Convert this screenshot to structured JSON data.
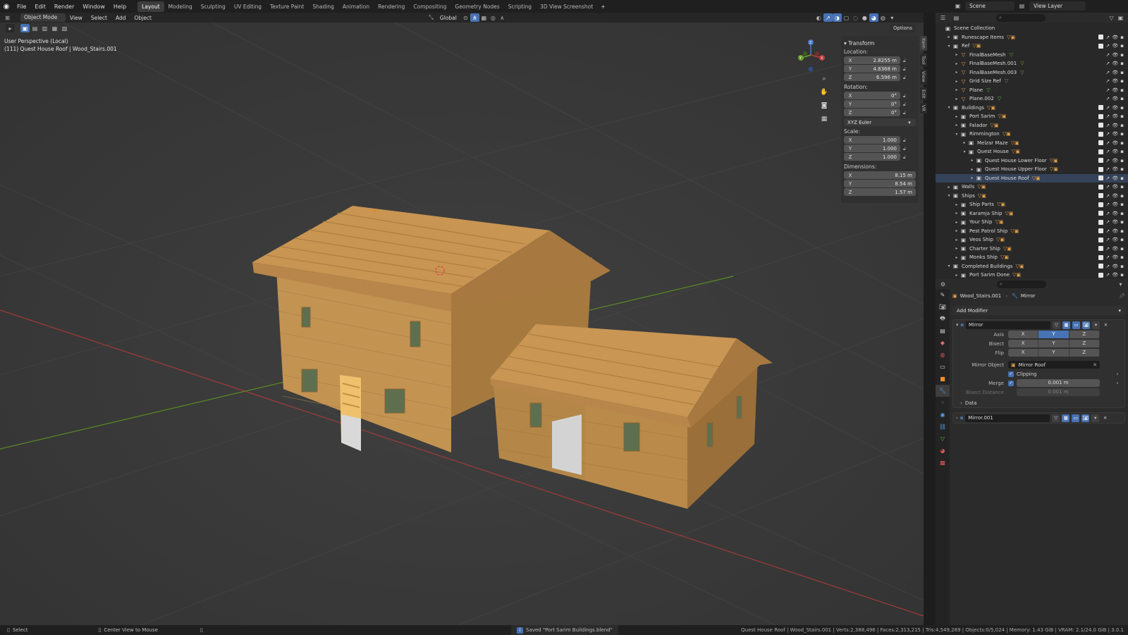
{
  "topbar": {
    "menus": [
      "File",
      "Edit",
      "Render",
      "Window",
      "Help"
    ],
    "workspaces": [
      "Layout",
      "Modeling",
      "Sculpting",
      "UV Editing",
      "Texture Paint",
      "Shading",
      "Animation",
      "Rendering",
      "Compositing",
      "Geometry Nodes",
      "Scripting",
      "3D View Screenshot"
    ],
    "active_workspace": "Layout",
    "scene": "Scene",
    "view_layer": "View Layer"
  },
  "viewport_header": {
    "mode": "Object Mode",
    "menus": [
      "View",
      "Select",
      "Add",
      "Object"
    ],
    "orientation": "Global",
    "options": "Options"
  },
  "viewport": {
    "view_name": "User Perspective (Local)",
    "object_info": "(111) Quest House Roof | Wood_Stairs.001",
    "axes": [
      "X",
      "Y",
      "Z"
    ]
  },
  "npanel": {
    "title": "Transform",
    "location_label": "Location:",
    "location": {
      "x": "2.8255 m",
      "y": "4.8368 m",
      "z": "6.596 m"
    },
    "rotation_label": "Rotation:",
    "rotation": {
      "x": "0°",
      "y": "0°",
      "z": "0°"
    },
    "rotation_mode": "XYZ Euler",
    "scale_label": "Scale:",
    "scale": {
      "x": "1.000",
      "y": "1.000",
      "z": "1.000"
    },
    "dimensions_label": "Dimensions:",
    "dimensions": {
      "x": "8.15 m",
      "y": "8.54 m",
      "z": "1.57 m"
    },
    "tabs": [
      "Item",
      "Tool",
      "View",
      "Edit",
      "VR"
    ]
  },
  "outliner": {
    "rows": [
      {
        "label": "Scene Collection"
      },
      {
        "label": "Runescape Items"
      },
      {
        "label": "Ref"
      },
      {
        "label": "FinalBaseMesh"
      },
      {
        "label": "FinalBaseMesh.001"
      },
      {
        "label": "FinalBaseMesh.003"
      },
      {
        "label": "Grid Size Ref"
      },
      {
        "label": "Plane"
      },
      {
        "label": "Plane.002"
      },
      {
        "label": "Buildings"
      },
      {
        "label": "Port Sarim"
      },
      {
        "label": "Falador"
      },
      {
        "label": "Rimmington"
      },
      {
        "label": "Melzar Maze"
      },
      {
        "label": "Quest House"
      },
      {
        "label": "Quest House Lower Floor"
      },
      {
        "label": "Quest House Upper Floor"
      },
      {
        "label": "Quest House Roof"
      },
      {
        "label": "Walls"
      },
      {
        "label": "Ships"
      },
      {
        "label": "Ship Parts"
      },
      {
        "label": "Karamja Ship"
      },
      {
        "label": "Your Ship"
      },
      {
        "label": "Pest Patrol Ship"
      },
      {
        "label": "Veos Ship"
      },
      {
        "label": "Charter Ship"
      },
      {
        "label": "Monks Ship"
      },
      {
        "label": "Completed Buildings"
      },
      {
        "label": "Port Sarim Done"
      }
    ]
  },
  "properties": {
    "object": "Wood_Stairs.001",
    "modifier_breadcrumb": "Mirror",
    "add_modifier": "Add Modifier",
    "mirror": {
      "name": "Mirror",
      "axis_label": "Axis",
      "bisect_label": "Bisect",
      "flip_label": "Flip",
      "axes": [
        "X",
        "Y",
        "Z"
      ],
      "mirror_object_label": "Mirror Object",
      "mirror_object": "Mirror Roof",
      "clipping_label": "Clipping",
      "merge_label": "Merge",
      "merge_value": "0.001 m",
      "bisect_distance_label": "Bisect Distance",
      "bisect_distance_value": "0.001 m",
      "data_label": "Data"
    },
    "mirror2_name": "Mirror.001"
  },
  "statusbar": {
    "select": "Select",
    "center_view": "Center View to Mouse",
    "saved_message": "Saved \"Port Sarim Buildings.blend\"",
    "stats": "Quest House Roof | Wood_Stairs.001 | Verts:2,388,496 | Faces:2,313,215 | Tris:4,549,289 | Objects:0/5,024 | Memory: 1.43 GiB | VRAM: 2.1/24.0 GiB | 3.0.1"
  },
  "colors": {
    "accent": "#4772b3",
    "wood": "#c4924d",
    "grid_x": "#b83a3a",
    "grid_y": "#6d9e2a"
  }
}
